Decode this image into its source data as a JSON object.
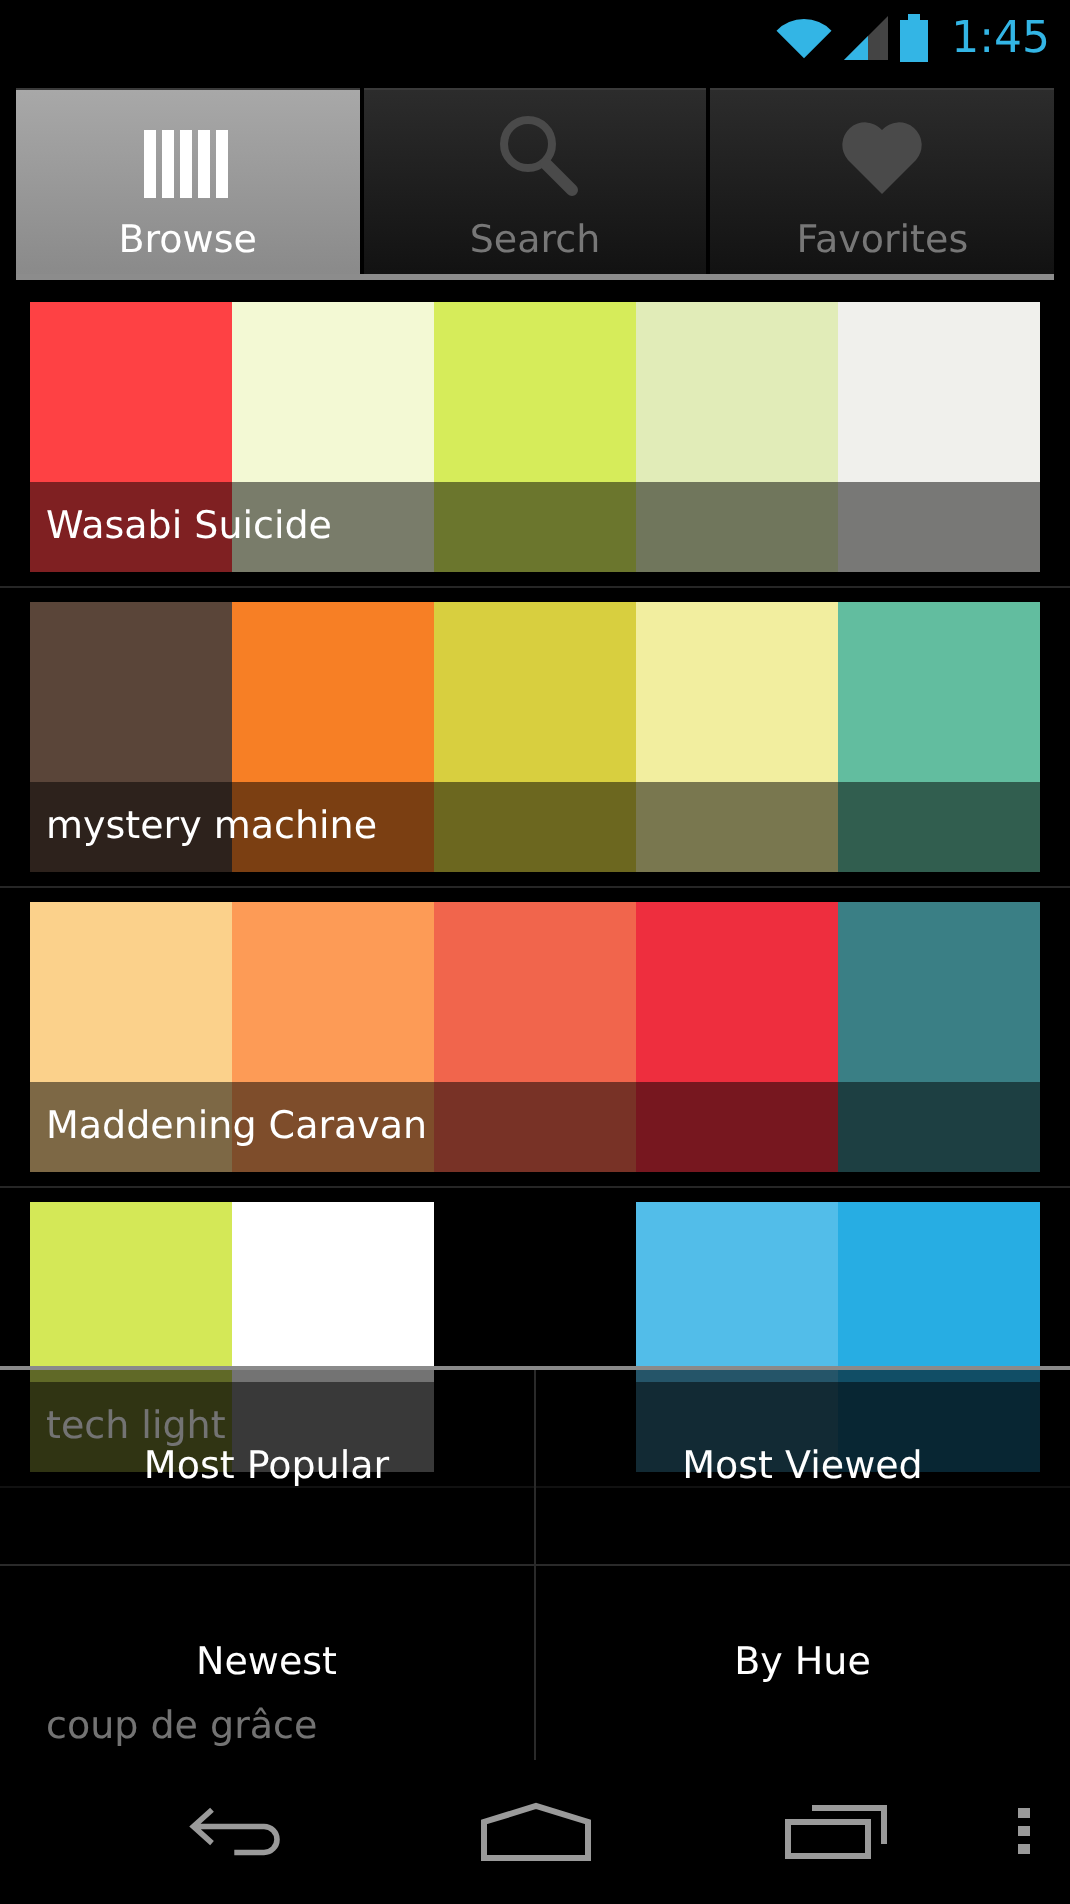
{
  "status_bar": {
    "time": "1:45"
  },
  "tabs": [
    {
      "label": "Browse",
      "selected": true
    },
    {
      "label": "Search",
      "selected": false
    },
    {
      "label": "Favorites",
      "selected": false
    }
  ],
  "palettes": [
    {
      "name": "Wasabi Suicide",
      "colors": [
        {
          "color": "#fe4144"
        },
        {
          "color": "#f3f9d4"
        },
        {
          "color": "#d6ec5a"
        },
        {
          "color": "#e1ecb8"
        },
        {
          "color": "#f0f0ec"
        }
      ]
    },
    {
      "name": "mystery machine",
      "colors": [
        {
          "color": "#5a4539"
        },
        {
          "color": "#f77f25"
        },
        {
          "color": "#d8cf3f"
        },
        {
          "color": "#f2ee9f"
        },
        {
          "color": "#62bd9f"
        }
      ]
    },
    {
      "name": "Maddening Caravan",
      "colors": [
        {
          "color": "#fbd18b"
        },
        {
          "color": "#fd9b56"
        },
        {
          "color": "#f1654c"
        },
        {
          "color": "#ee2e3e"
        },
        {
          "color": "#3a7f85"
        }
      ]
    },
    {
      "name": "tech light",
      "colors": [
        {
          "color": "#d4e857"
        },
        {
          "color": "#ffffff"
        },
        {
          "color": "#000000"
        },
        {
          "color": "#52bde9"
        },
        {
          "color": "#27ade3"
        }
      ]
    },
    {
      "name": "coup de grâce"
    }
  ],
  "menu": [
    "Most Popular",
    "Most Viewed",
    "Newest",
    "By Hue"
  ]
}
